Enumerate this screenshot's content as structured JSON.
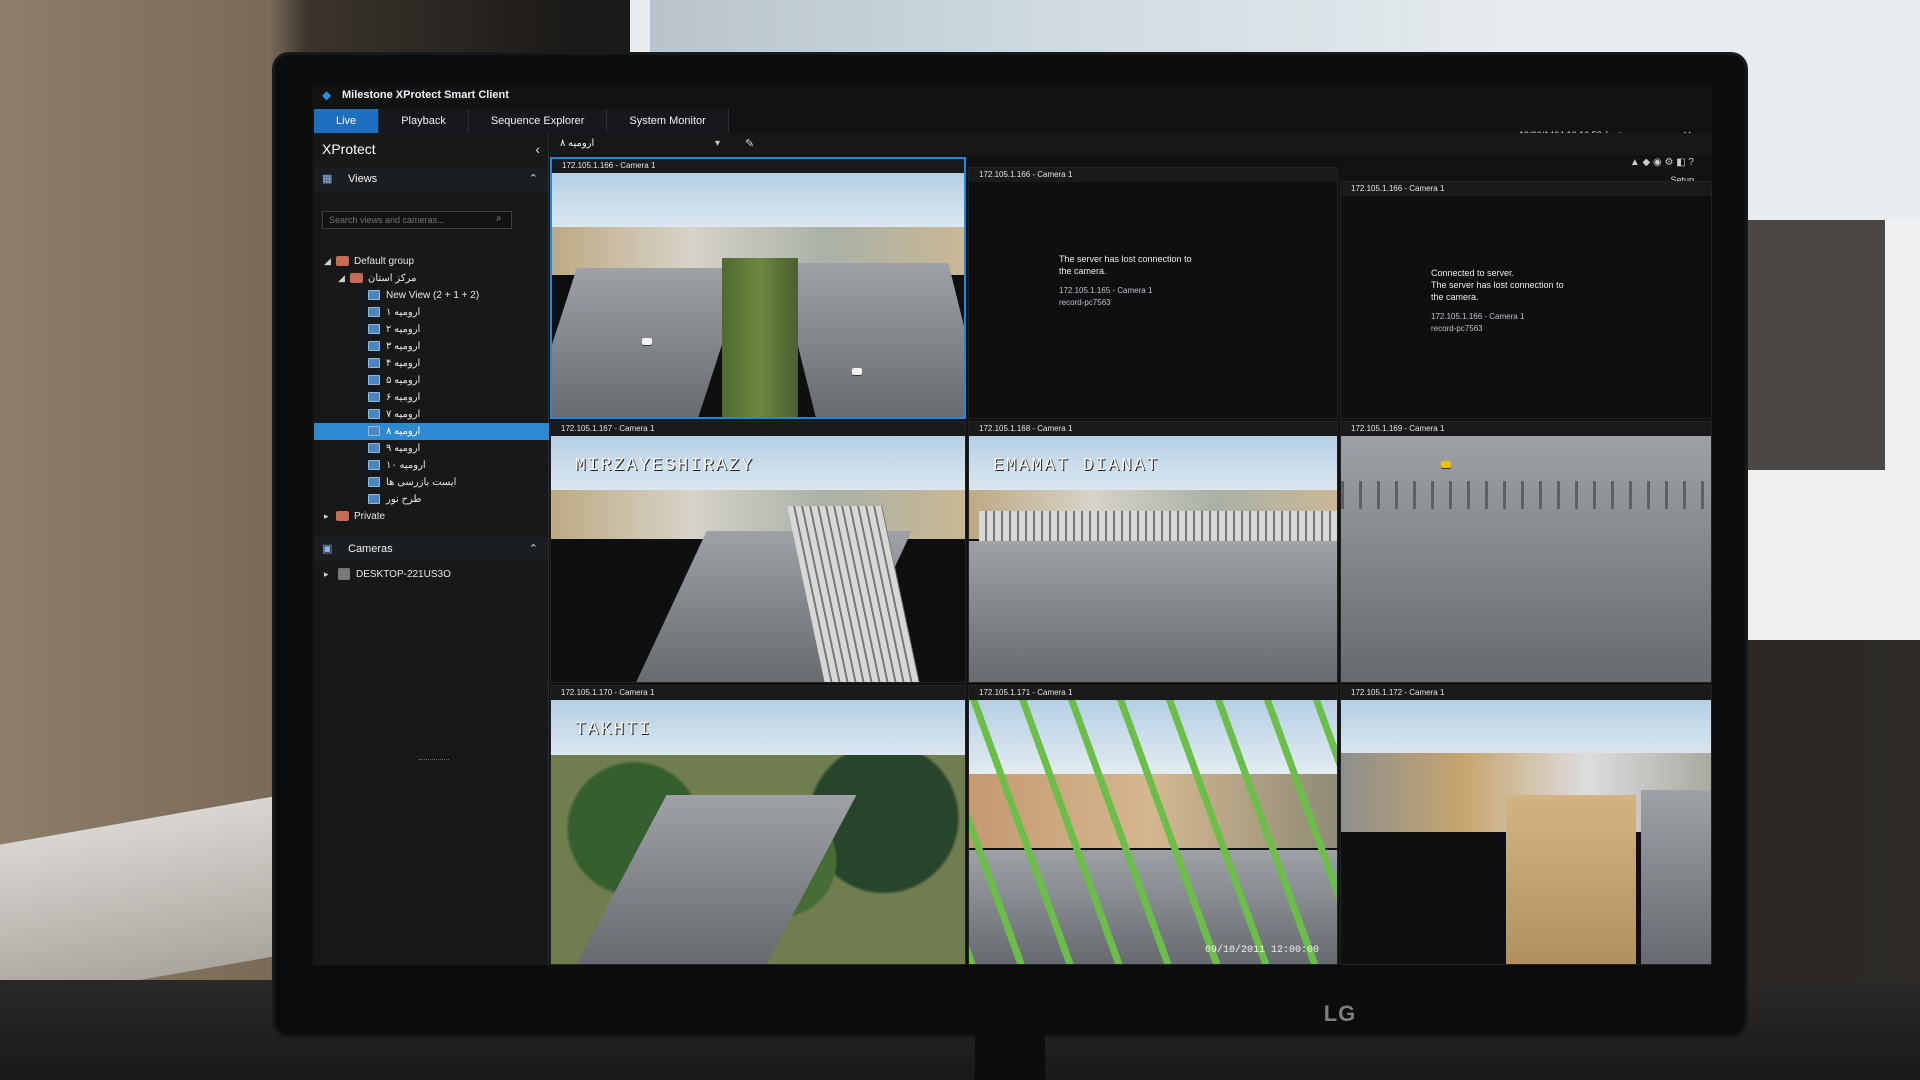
{
  "app": {
    "title": "Milestone XProtect Smart Client",
    "brand": "XProtect",
    "datetime": "19/06/1404 10:16:53 ق.ظ"
  },
  "tabs": [
    {
      "label": "Live"
    },
    {
      "label": "Playback"
    },
    {
      "label": "Sequence Explorer"
    },
    {
      "label": "System Monitor"
    }
  ],
  "sidebar": {
    "views_header": "Views",
    "search_placeholder": "Search views and cameras...",
    "tree": [
      {
        "label": "Default group",
        "level": 1
      },
      {
        "label": "مرکز استان",
        "level": 2
      },
      {
        "label": "New View (2 + 1 + 2)",
        "level": 3
      },
      {
        "label": "ارومیه ۱",
        "level": 3
      },
      {
        "label": "ارومیه ۲",
        "level": 3
      },
      {
        "label": "ارومیه ۳",
        "level": 3
      },
      {
        "label": "ارومیه ۴",
        "level": 3
      },
      {
        "label": "ارومیه ۵",
        "level": 3
      },
      {
        "label": "ارومیه ۶",
        "level": 3
      },
      {
        "label": "ارومیه ۷",
        "level": 3
      },
      {
        "label": "ارومیه ۸",
        "level": 3,
        "selected": true
      },
      {
        "label": "ارومیه ۹",
        "level": 3
      },
      {
        "label": "ارومیه ۱۰",
        "level": 3
      },
      {
        "label": "ایست بازرسی ها",
        "level": 3
      },
      {
        "label": "طرح نور",
        "level": 3
      },
      {
        "label": "Private",
        "level": 1
      }
    ],
    "cameras_header": "Cameras",
    "camera_item": "DESKTOP-221US3O"
  },
  "view_bar": {
    "current_view": "ارومیه ۸",
    "setup": "Setup"
  },
  "tiles": [
    {
      "header": "172.105.1.166 - Camera 1",
      "overlay": "",
      "time": ""
    },
    {
      "header": "172.105.1.166 - Camera 1",
      "message": "The server has lost connection to the camera.",
      "sub": "172.105.1.165 - Camera 1\nrecord-pc7563"
    },
    {
      "header": "172.105.1.166 - Camera 1",
      "message": "Connected to server.\nThe server has lost connection to the camera.",
      "sub": "172.105.1.166 - Camera 1\nrecord-pc7563"
    },
    {
      "header": "172.105.1.167 - Camera 1",
      "overlay": "MIRZAYESHIRAZY"
    },
    {
      "header": "172.105.1.168 - Camera 1",
      "overlay": "EMAMAT DIANAT"
    },
    {
      "header": "172.105.1.169 - Camera 1",
      "overlay": ""
    },
    {
      "header": "172.105.1.170 - Camera 1",
      "overlay": "TAKHTI"
    },
    {
      "header": "172.105.1.171 - Camera 1",
      "overlay": "",
      "time": "09/10/2011 12:00:00"
    },
    {
      "header": "172.105.1.172 - Camera 1",
      "overlay": ""
    }
  ],
  "monitor": {
    "brand": "LG"
  }
}
